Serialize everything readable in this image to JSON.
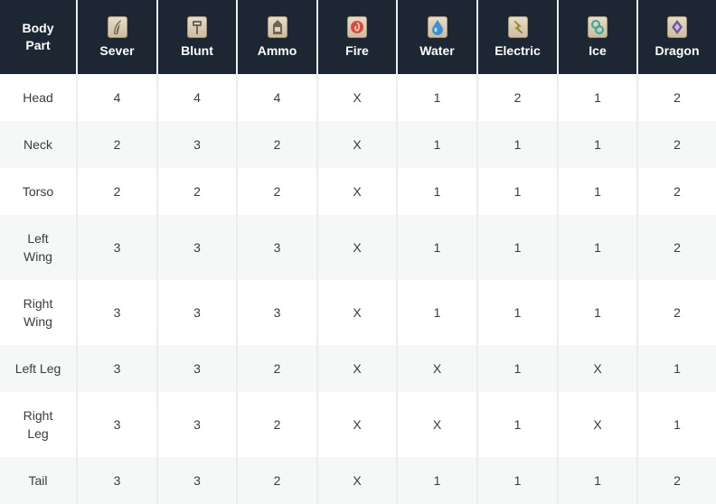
{
  "table": {
    "header": {
      "body_part": "Body\nPart",
      "columns": [
        {
          "key": "sever",
          "label": "Sever",
          "icon": "sever-icon"
        },
        {
          "key": "blunt",
          "label": "Blunt",
          "icon": "blunt-icon"
        },
        {
          "key": "ammo",
          "label": "Ammo",
          "icon": "ammo-icon"
        },
        {
          "key": "fire",
          "label": "Fire",
          "icon": "fire-icon"
        },
        {
          "key": "water",
          "label": "Water",
          "icon": "water-icon"
        },
        {
          "key": "electric",
          "label": "Electric",
          "icon": "electric-icon"
        },
        {
          "key": "ice",
          "label": "Ice",
          "icon": "ice-icon"
        },
        {
          "key": "dragon",
          "label": "Dragon",
          "icon": "dragon-icon"
        }
      ]
    },
    "rows": [
      {
        "part": "Head",
        "values": [
          "4",
          "4",
          "4",
          "X",
          "1",
          "2",
          "1",
          "2"
        ]
      },
      {
        "part": "Neck",
        "values": [
          "2",
          "3",
          "2",
          "X",
          "1",
          "1",
          "1",
          "2"
        ]
      },
      {
        "part": "Torso",
        "values": [
          "2",
          "2",
          "2",
          "X",
          "1",
          "1",
          "1",
          "2"
        ]
      },
      {
        "part": "Left\nWing",
        "values": [
          "3",
          "3",
          "3",
          "X",
          "1",
          "1",
          "1",
          "2"
        ]
      },
      {
        "part": "Right\nWing",
        "values": [
          "3",
          "3",
          "3",
          "X",
          "1",
          "1",
          "1",
          "2"
        ]
      },
      {
        "part": "Left Leg",
        "values": [
          "3",
          "3",
          "2",
          "X",
          "X",
          "1",
          "X",
          "1"
        ]
      },
      {
        "part": "Right\nLeg",
        "values": [
          "3",
          "3",
          "2",
          "X",
          "X",
          "1",
          "X",
          "1"
        ]
      },
      {
        "part": "Tail",
        "values": [
          "3",
          "3",
          "2",
          "X",
          "1",
          "1",
          "1",
          "2"
        ]
      }
    ]
  }
}
